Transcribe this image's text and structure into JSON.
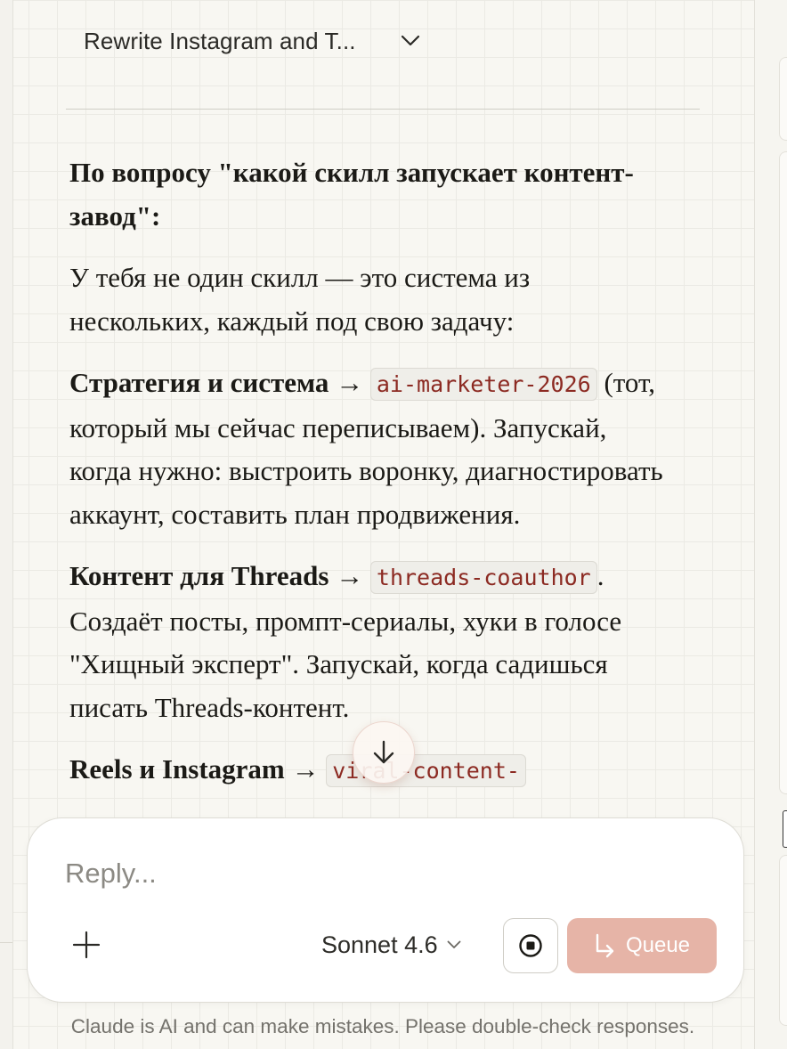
{
  "header": {
    "title": "Rewrite Instagram and T..."
  },
  "message": {
    "heading": "По вопросу \"какой скилл запускает контент-завод\":",
    "intro": "У тебя не один скилл — это система из нескольких, каждый под свою задачу:",
    "items": [
      {
        "label": "Стратегия и система",
        "arrow": " → ",
        "code": "ai-marketer-2026",
        "description": " (тот, который мы сейчас переписываем). Запускай, когда нужно: выстроить воронку, диагностировать аккаунт, составить план продвижения."
      },
      {
        "label": "Контент для Threads",
        "arrow": " → ",
        "code": "threads-coauthor",
        "description": ". Создаёт посты, промпт-сериалы, хуки в голосе \"Хищный эксперт\". Запускай, когда садишься писать Threads-контент."
      },
      {
        "label": "Reels и Instagram",
        "arrow": " → ",
        "code": "viral-content-",
        "description": ""
      }
    ]
  },
  "composer": {
    "placeholder": "Reply...",
    "model": "Sonnet 4.6",
    "queue_label": "Queue"
  },
  "footer": {
    "disclaimer": "Claude is AI and can make mistakes. Please double-check responses."
  },
  "icons": {
    "title_chevron": "chevron-down-icon",
    "scroll": "arrow-down-icon",
    "attach": "plus-icon",
    "model_chevron": "chevron-down-icon",
    "stop": "stop-icon",
    "queue": "queue-arrow-icon"
  },
  "colors": {
    "accent": "#e6b4a7",
    "code_text": "#8c2a22",
    "background": "#f8f7f2"
  }
}
